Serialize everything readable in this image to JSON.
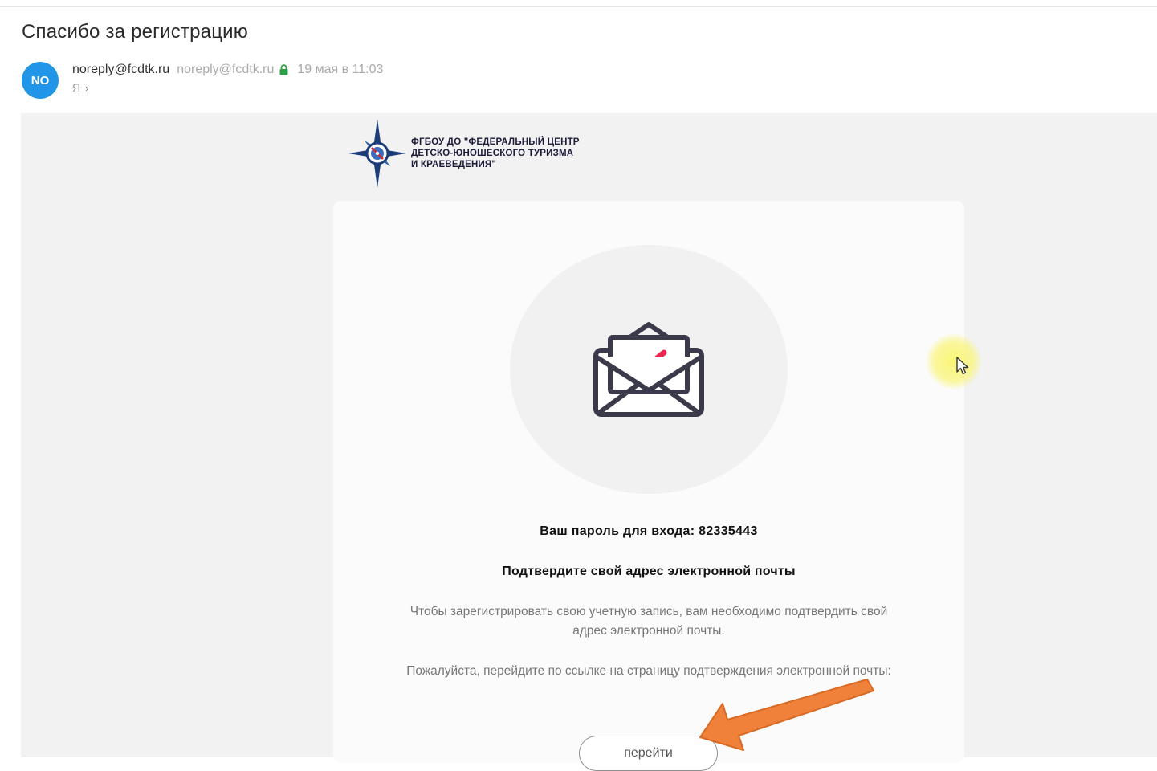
{
  "email": {
    "subject": "Спасибо за регистрацию",
    "avatar_initials": "NO",
    "sender_name": "noreply@fcdtk.ru",
    "sender_email": "noreply@fcdtk.ru",
    "date": "19 мая в 11:03",
    "recipient": "Я",
    "icons": {
      "lock": "lock-icon",
      "recipient": "chevron-right-icon"
    }
  },
  "message": {
    "brand_lines": [
      "ФГБОУ ДО \"ФЕДЕРАЛЬНЫЙ ЦЕНТР",
      "ДЕТСКО-ЮНОШЕСКОГО ТУРИЗМА",
      "И КРАЕВЕДЕНИЯ\""
    ],
    "hero_icon": "envelope-check-icon",
    "password_line": "Ваш пароль для входа: 82335443",
    "confirm_title": "Подтвердите свой адрес электронной почты",
    "paragraph1": "Чтобы зарегистрировать свою учетную запись, вам необходимо подтвердить свой адрес электронной почты.",
    "paragraph2": "Пожалуйста, перейдите по ссылке на страницу подтверждения электронной почты:",
    "button_label": "перейти"
  },
  "colors": {
    "avatar": "#2196e8",
    "lock": "#2e9e47",
    "check": "#e8284f",
    "envelope_stroke": "#3a3a4a",
    "annotation_arrow": "#f0813a",
    "cursor_highlight": "#faf56e"
  },
  "overlay": {
    "cursor_icon": "mouse-pointer-icon",
    "annotation": "arrow-annotation-icon"
  }
}
